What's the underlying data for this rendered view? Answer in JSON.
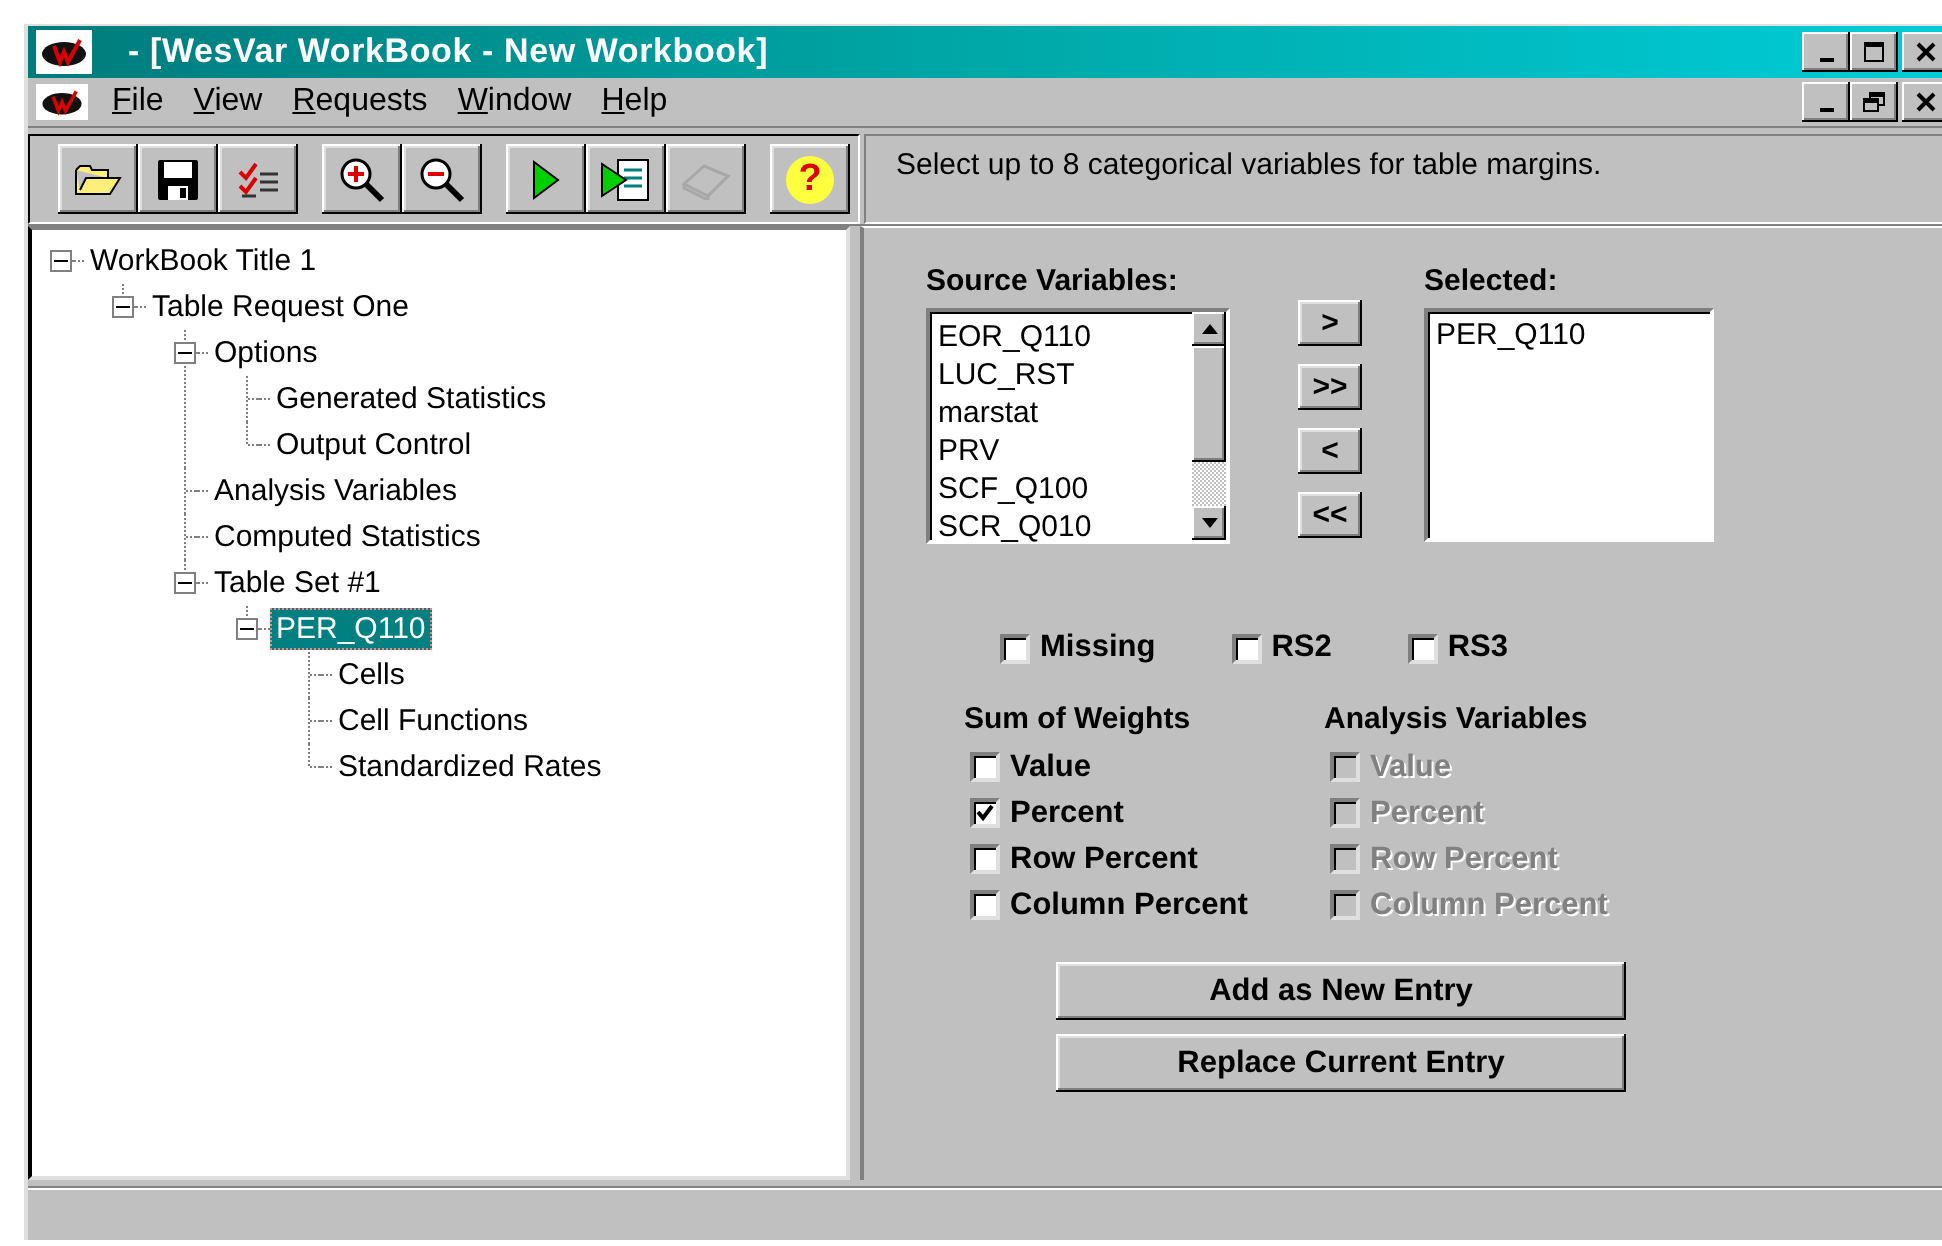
{
  "window": {
    "title": "- [WesVar WorkBook - New Workbook]"
  },
  "menu": [
    {
      "label": "File"
    },
    {
      "label": "View"
    },
    {
      "label": "Requests"
    },
    {
      "label": "Window"
    },
    {
      "label": "Help"
    }
  ],
  "toolbar": [
    [
      {
        "kind": "open",
        "disabled": false
      },
      {
        "kind": "save",
        "disabled": false
      },
      {
        "kind": "checklist",
        "disabled": false
      }
    ],
    [
      {
        "kind": "zoom-in",
        "disabled": false
      },
      {
        "kind": "zoom-out",
        "disabled": false
      }
    ],
    [
      {
        "kind": "run",
        "disabled": false
      },
      {
        "kind": "run-report",
        "disabled": false
      },
      {
        "kind": "book",
        "disabled": true
      }
    ],
    [
      {
        "kind": "help",
        "glyph": "?",
        "disabled": false
      }
    ]
  ],
  "hint": "Select up to 8 categorical variables for table margins.",
  "tree": [
    {
      "label": "WorkBook Title 1",
      "selected": false,
      "expanded": true,
      "children": [
        {
          "label": "Table Request One",
          "selected": false,
          "expanded": true,
          "children": [
            {
              "label": "Options",
              "selected": false,
              "expanded": true,
              "children": [
                {
                  "label": "Generated Statistics",
                  "selected": false
                },
                {
                  "label": "Output Control",
                  "selected": false
                }
              ]
            },
            {
              "label": "Analysis Variables",
              "selected": false
            },
            {
              "label": "Computed Statistics",
              "selected": false
            },
            {
              "label": "Table Set #1",
              "selected": false,
              "expanded": true,
              "children": [
                {
                  "label": "PER_Q110",
                  "selected": true,
                  "expanded": true,
                  "children": [
                    {
                      "label": "Cells",
                      "selected": false
                    },
                    {
                      "label": "Cell Functions",
                      "selected": false
                    },
                    {
                      "label": "Standardized Rates",
                      "selected": false
                    }
                  ]
                }
              ]
            }
          ]
        }
      ]
    }
  ],
  "source": {
    "label": "Source Variables:",
    "items": [
      "EOR_Q110",
      "LUC_RST",
      "marstat",
      "PRV",
      "SCF_Q100",
      "SCR_Q010"
    ]
  },
  "move_buttons": [
    ">",
    ">>",
    "<",
    "<<"
  ],
  "selected_list": {
    "label": "Selected:",
    "items": [
      "PER_Q110"
    ]
  },
  "options": [
    {
      "label": "Missing",
      "checked": false
    },
    {
      "label": "RS2",
      "checked": false
    },
    {
      "label": "RS3",
      "checked": false
    }
  ],
  "groups": [
    {
      "title": "Sum of Weights",
      "disabled": false,
      "items": [
        {
          "label": "Value",
          "checked": false
        },
        {
          "label": "Percent",
          "checked": true
        },
        {
          "label": "Row Percent",
          "checked": false
        },
        {
          "label": "Column Percent",
          "checked": false
        }
      ]
    },
    {
      "title": "Analysis Variables",
      "disabled": true,
      "items": [
        {
          "label": "Value",
          "checked": false
        },
        {
          "label": "Percent",
          "checked": false
        },
        {
          "label": "Row Percent",
          "checked": false
        },
        {
          "label": "Column Percent",
          "checked": false
        }
      ]
    }
  ],
  "actions": [
    "Add as New Entry",
    "Replace Current Entry"
  ]
}
